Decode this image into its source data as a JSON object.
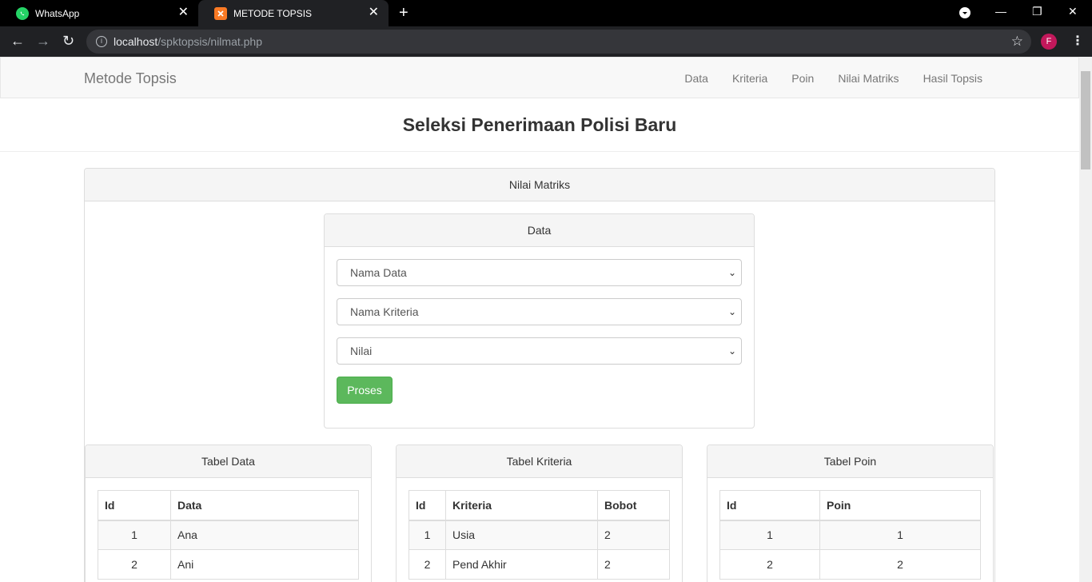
{
  "browser": {
    "tabs": [
      {
        "title": "WhatsApp"
      },
      {
        "title": "METODE TOPSIS"
      }
    ],
    "url_host": "localhost",
    "url_path": "/spktopsis/nilmat.php",
    "profile_initial": "F"
  },
  "navbar": {
    "brand": "Metode Topsis",
    "links": [
      "Data",
      "Kriteria",
      "Poin",
      "Nilai Matriks",
      "Hasil Topsis"
    ]
  },
  "page_title": "Seleksi Penerimaan Polisi Baru",
  "main_panel": {
    "heading": "Nilai Matriks",
    "form_panel": {
      "heading": "Data",
      "select_data": "Nama Data",
      "select_kriteria": "Nama Kriteria",
      "select_nilai": "Nilai",
      "submit_label": "Proses"
    }
  },
  "tabel_data": {
    "heading": "Tabel Data",
    "columns": [
      "Id",
      "Data"
    ],
    "rows": [
      [
        "1",
        "Ana"
      ],
      [
        "2",
        "Ani"
      ]
    ]
  },
  "tabel_kriteria": {
    "heading": "Tabel Kriteria",
    "columns": [
      "Id",
      "Kriteria",
      "Bobot"
    ],
    "rows": [
      [
        "1",
        "Usia",
        "2"
      ],
      [
        "2",
        "Pend Akhir",
        "2"
      ]
    ]
  },
  "tabel_poin": {
    "heading": "Tabel Poin",
    "columns": [
      "Id",
      "Poin"
    ],
    "rows": [
      [
        "1",
        "1"
      ],
      [
        "2",
        "2"
      ]
    ]
  }
}
